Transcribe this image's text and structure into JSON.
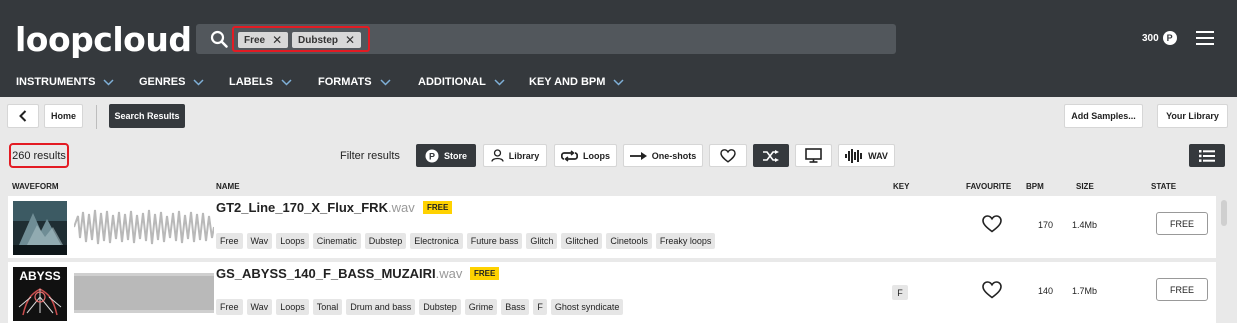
{
  "header": {
    "logo": "loopcloud",
    "search_chips": [
      {
        "label": "Free"
      },
      {
        "label": "Dubstep"
      }
    ],
    "credits": "300",
    "credit_badge": "P"
  },
  "nav": {
    "items": [
      "INSTRUMENTS",
      "GENRES",
      "LABELS",
      "FORMATS",
      "ADDITIONAL",
      "KEY AND BPM"
    ]
  },
  "toolbar": {
    "home": "Home",
    "search_results": "Search Results",
    "add_samples": "Add Samples...",
    "your_library": "Your Library"
  },
  "filters": {
    "results": "260 results",
    "label": "Filter results",
    "store": "Store",
    "library": "Library",
    "loops": "Loops",
    "oneshots": "One-shots",
    "wav": "WAV"
  },
  "table": {
    "headers": {
      "waveform": "WAVEFORM",
      "name": "NAME",
      "key": "KEY",
      "favourite": "FAVOURITE",
      "bpm": "BPM",
      "size": "SIZE",
      "state": "STATE"
    },
    "rows": [
      {
        "name": "GT2_Line_170_X_Flux_FRK",
        "ext": ".wav",
        "badge": "FREE",
        "tags": [
          "Free",
          "Wav",
          "Loops",
          "Cinematic",
          "Dubstep",
          "Electronica",
          "Future bass",
          "Glitch",
          "Glitched",
          "Cinetools",
          "Freaky loops"
        ],
        "key": "",
        "bpm": "170",
        "size": "1.4Mb",
        "state": "FREE"
      },
      {
        "name": "GS_ABYSS_140_F_BASS_MUZAIRI",
        "ext": ".wav",
        "badge": "FREE",
        "thumb_text": "ABYSS",
        "tags": [
          "Free",
          "Wav",
          "Loops",
          "Tonal",
          "Drum and bass",
          "Dubstep",
          "Grime",
          "Bass",
          "F",
          "Ghost syndicate"
        ],
        "key": "F",
        "bpm": "140",
        "size": "1.7Mb",
        "state": "FREE"
      }
    ]
  },
  "colors": {
    "header_bg": "#35393d",
    "highlight": "#e31b23",
    "free_badge": "#ffd200"
  }
}
